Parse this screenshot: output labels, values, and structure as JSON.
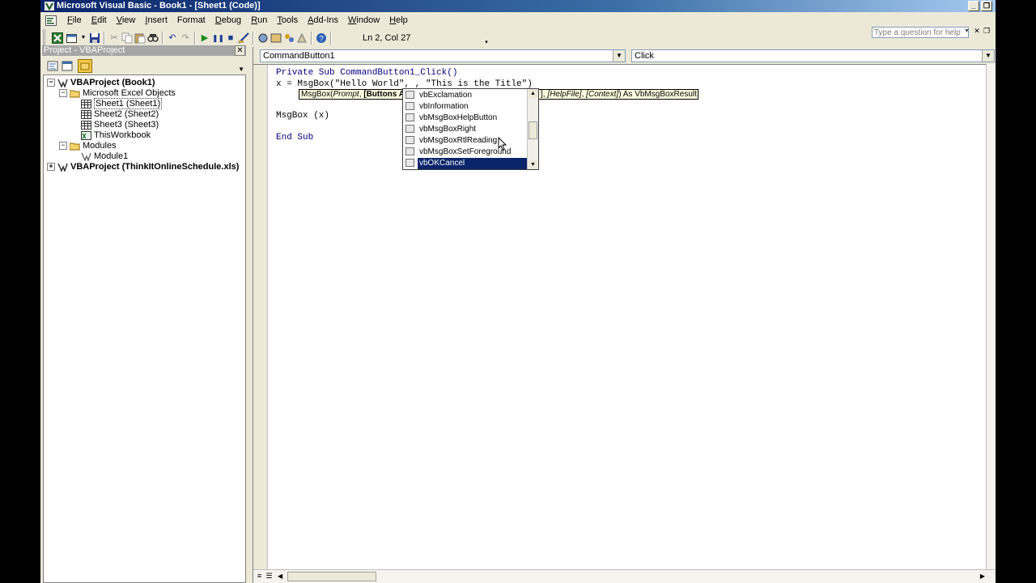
{
  "window": {
    "title": "Microsoft Visual Basic - Book1 - [Sheet1 (Code)]"
  },
  "menu": {
    "items": [
      {
        "u": "F",
        "rest": "ile"
      },
      {
        "u": "E",
        "rest": "dit"
      },
      {
        "u": "V",
        "rest": "iew"
      },
      {
        "u": "I",
        "rest": "nsert"
      },
      {
        "u": "",
        "rest": "Format",
        "u2": "o"
      },
      {
        "u": "D",
        "rest": "ebug"
      },
      {
        "u": "R",
        "rest": "un"
      },
      {
        "u": "T",
        "rest": "ools"
      },
      {
        "u": "A",
        "rest": "dd-Ins"
      },
      {
        "u": "W",
        "rest": "indow"
      },
      {
        "u": "H",
        "rest": "elp"
      }
    ],
    "help_placeholder": "Type a question for help"
  },
  "toolbar": {
    "position": "Ln 2, Col 27"
  },
  "project_panel": {
    "title": "Project - VBAProject",
    "nodes": [
      {
        "label": "VBAProject (Book1)"
      },
      {
        "label": "Microsoft Excel Objects"
      },
      {
        "label": "Sheet1 (Sheet1)"
      },
      {
        "label": "Sheet2 (Sheet2)"
      },
      {
        "label": "Sheet3 (Sheet3)"
      },
      {
        "label": "ThisWorkbook"
      },
      {
        "label": "Modules"
      },
      {
        "label": "Module1"
      },
      {
        "label": "VBAProject (ThinkItOnlineSchedule.xls)"
      }
    ]
  },
  "code_window": {
    "object_combo": "CommandButton1",
    "procedure_combo": "Click",
    "lines": [
      {
        "kw1": "Private Sub ",
        "text": "CommandButton1_Click()"
      },
      {
        "text": "x = MsgBox(\"Hello World\", , \"This is the Title\")"
      },
      {
        "text": "MsgBox (x)"
      },
      {
        "kw1": "End Sub",
        "text": ""
      }
    ],
    "param_tip": {
      "prefix": "MsgBox(",
      "prompt": "Prompt",
      "sep": ", ",
      "buttons": "[Buttons A",
      "suffix_help": "[HelpFile]",
      "suffix_context": "[Context]",
      "result": ") As VbMsgBoxResult"
    },
    "autocomplete": [
      "vbExclamation",
      "vbInformation",
      "vbMsgBoxHelpButton",
      "vbMsgBoxRight",
      "vbMsgBoxRtlReading",
      "vbMsgBoxSetForeground",
      "vbOKCancel"
    ]
  },
  "colors": {
    "titlebar_start": "#0a246a",
    "keyword": "#00007f",
    "selection": "#0a246a",
    "tooltip_bg": "#ffffe1"
  }
}
